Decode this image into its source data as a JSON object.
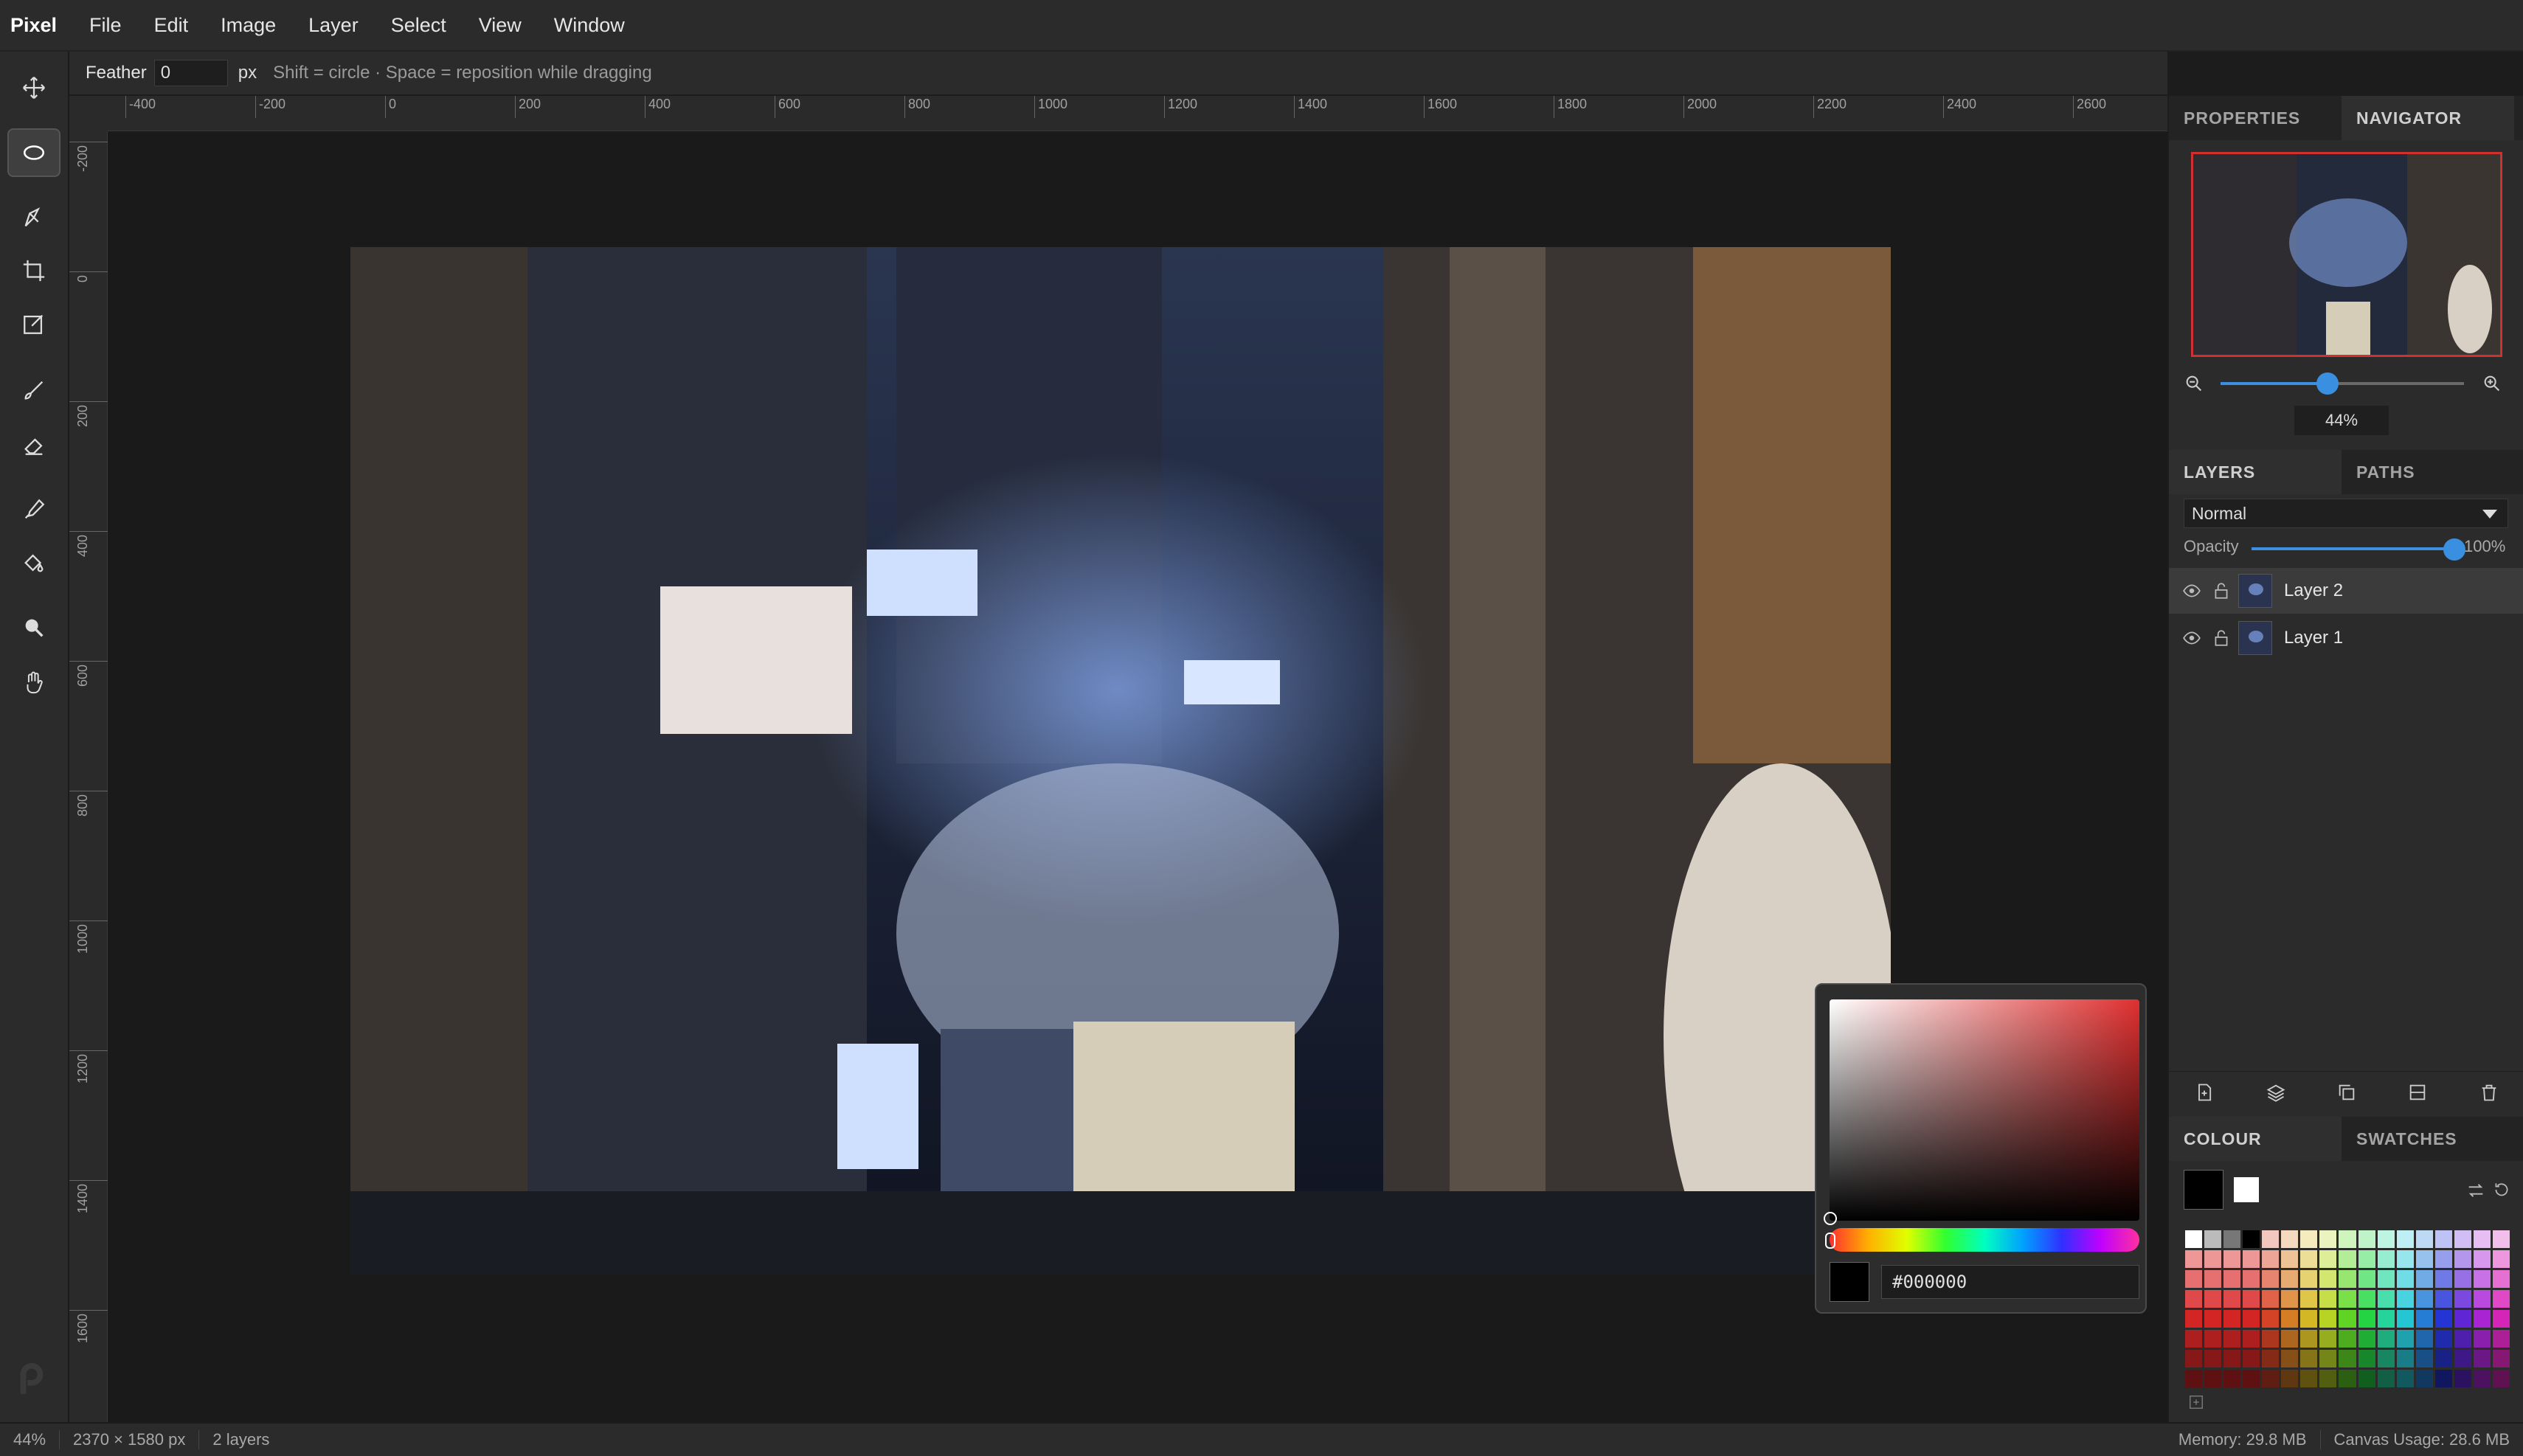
{
  "app": {
    "name": "Pixel"
  },
  "menu": [
    "File",
    "Edit",
    "Image",
    "Layer",
    "Select",
    "View",
    "Window"
  ],
  "options": {
    "feather_label": "Feather",
    "feather_value": "0",
    "unit": "px",
    "hint": "Shift = circle · Space = reposition while dragging"
  },
  "ruler": {
    "top": [
      "-400",
      "-200",
      "0",
      "200",
      "400",
      "600",
      "800",
      "1000",
      "1200",
      "1400",
      "1600",
      "1800",
      "2000",
      "2200",
      "2400",
      "2600"
    ],
    "left": [
      "-200",
      "0",
      "200",
      "400",
      "600",
      "800",
      "1000",
      "1200",
      "1400",
      "1600"
    ]
  },
  "panels": {
    "top_tabs": [
      "PROPERTIES",
      "NAVIGATOR"
    ],
    "zoom_percent": "44%",
    "zoom_fraction": 0.44,
    "layer_tabs": [
      "LAYERS",
      "PATHS"
    ],
    "blend_mode": "Normal",
    "opacity_label": "Opacity",
    "opacity_value": "100%",
    "layers": [
      {
        "name": "Layer 2"
      },
      {
        "name": "Layer 1"
      }
    ],
    "colour_tabs": [
      "COLOUR",
      "SWATCHES"
    ]
  },
  "color_picker": {
    "hex": "#000000"
  },
  "status": {
    "zoom": "44%",
    "dimensions": "2370 × 1580 px",
    "layers": "2 layers",
    "memory": "Memory: 29.8 MB",
    "canvas_usage": "Canvas Usage: 28.6 MB"
  },
  "colors": {
    "accent": "#3b8fe0",
    "navigator_frame": "#d03030"
  }
}
